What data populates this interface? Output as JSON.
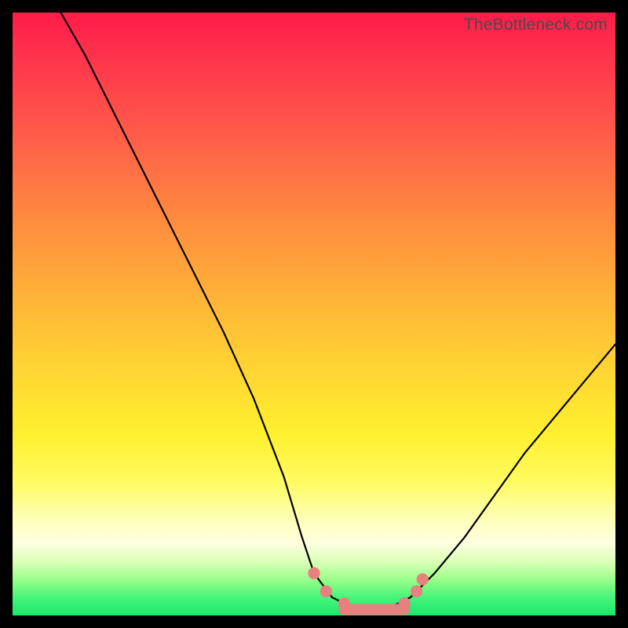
{
  "watermark": "TheBottleneck.com",
  "colors": {
    "frame": "#000000",
    "curve": "#000000",
    "marker": "#e98080"
  },
  "chart_data": {
    "type": "line",
    "title": "",
    "xlabel": "",
    "ylabel": "",
    "xlim": [
      0,
      100
    ],
    "ylim": [
      0,
      100
    ],
    "grid": false,
    "legend": false,
    "background_gradient_stops": [
      {
        "pos": 0,
        "color": "#ff1b4a"
      },
      {
        "pos": 20,
        "color": "#ff5b49"
      },
      {
        "pos": 48,
        "color": "#ffb537"
      },
      {
        "pos": 70,
        "color": "#fff02f"
      },
      {
        "pos": 88,
        "color": "#feffe0"
      },
      {
        "pos": 100,
        "color": "#19e86c"
      }
    ],
    "series": [
      {
        "name": "bottleneck-curve",
        "x": [
          8,
          12,
          16,
          20,
          25,
          30,
          35,
          40,
          45,
          48,
          50,
          53,
          56,
          60,
          63,
          66,
          70,
          75,
          80,
          85,
          90,
          95,
          100
        ],
        "y": [
          100,
          93,
          85,
          77,
          67,
          57,
          47,
          36,
          23,
          13,
          7,
          3,
          1.5,
          1,
          1.5,
          3,
          7,
          13,
          20,
          27,
          33,
          39,
          45
        ]
      }
    ],
    "markers": {
      "name": "optimal-range",
      "shape": "circle",
      "color": "#e98080",
      "points": [
        {
          "x": 50,
          "y": 7
        },
        {
          "x": 52,
          "y": 4
        },
        {
          "x": 55,
          "y": 2
        },
        {
          "x": 65,
          "y": 2
        },
        {
          "x": 67,
          "y": 4
        },
        {
          "x": 68,
          "y": 6
        }
      ],
      "flat_segment": {
        "x0": 55,
        "x1": 65,
        "y": 1
      }
    }
  }
}
